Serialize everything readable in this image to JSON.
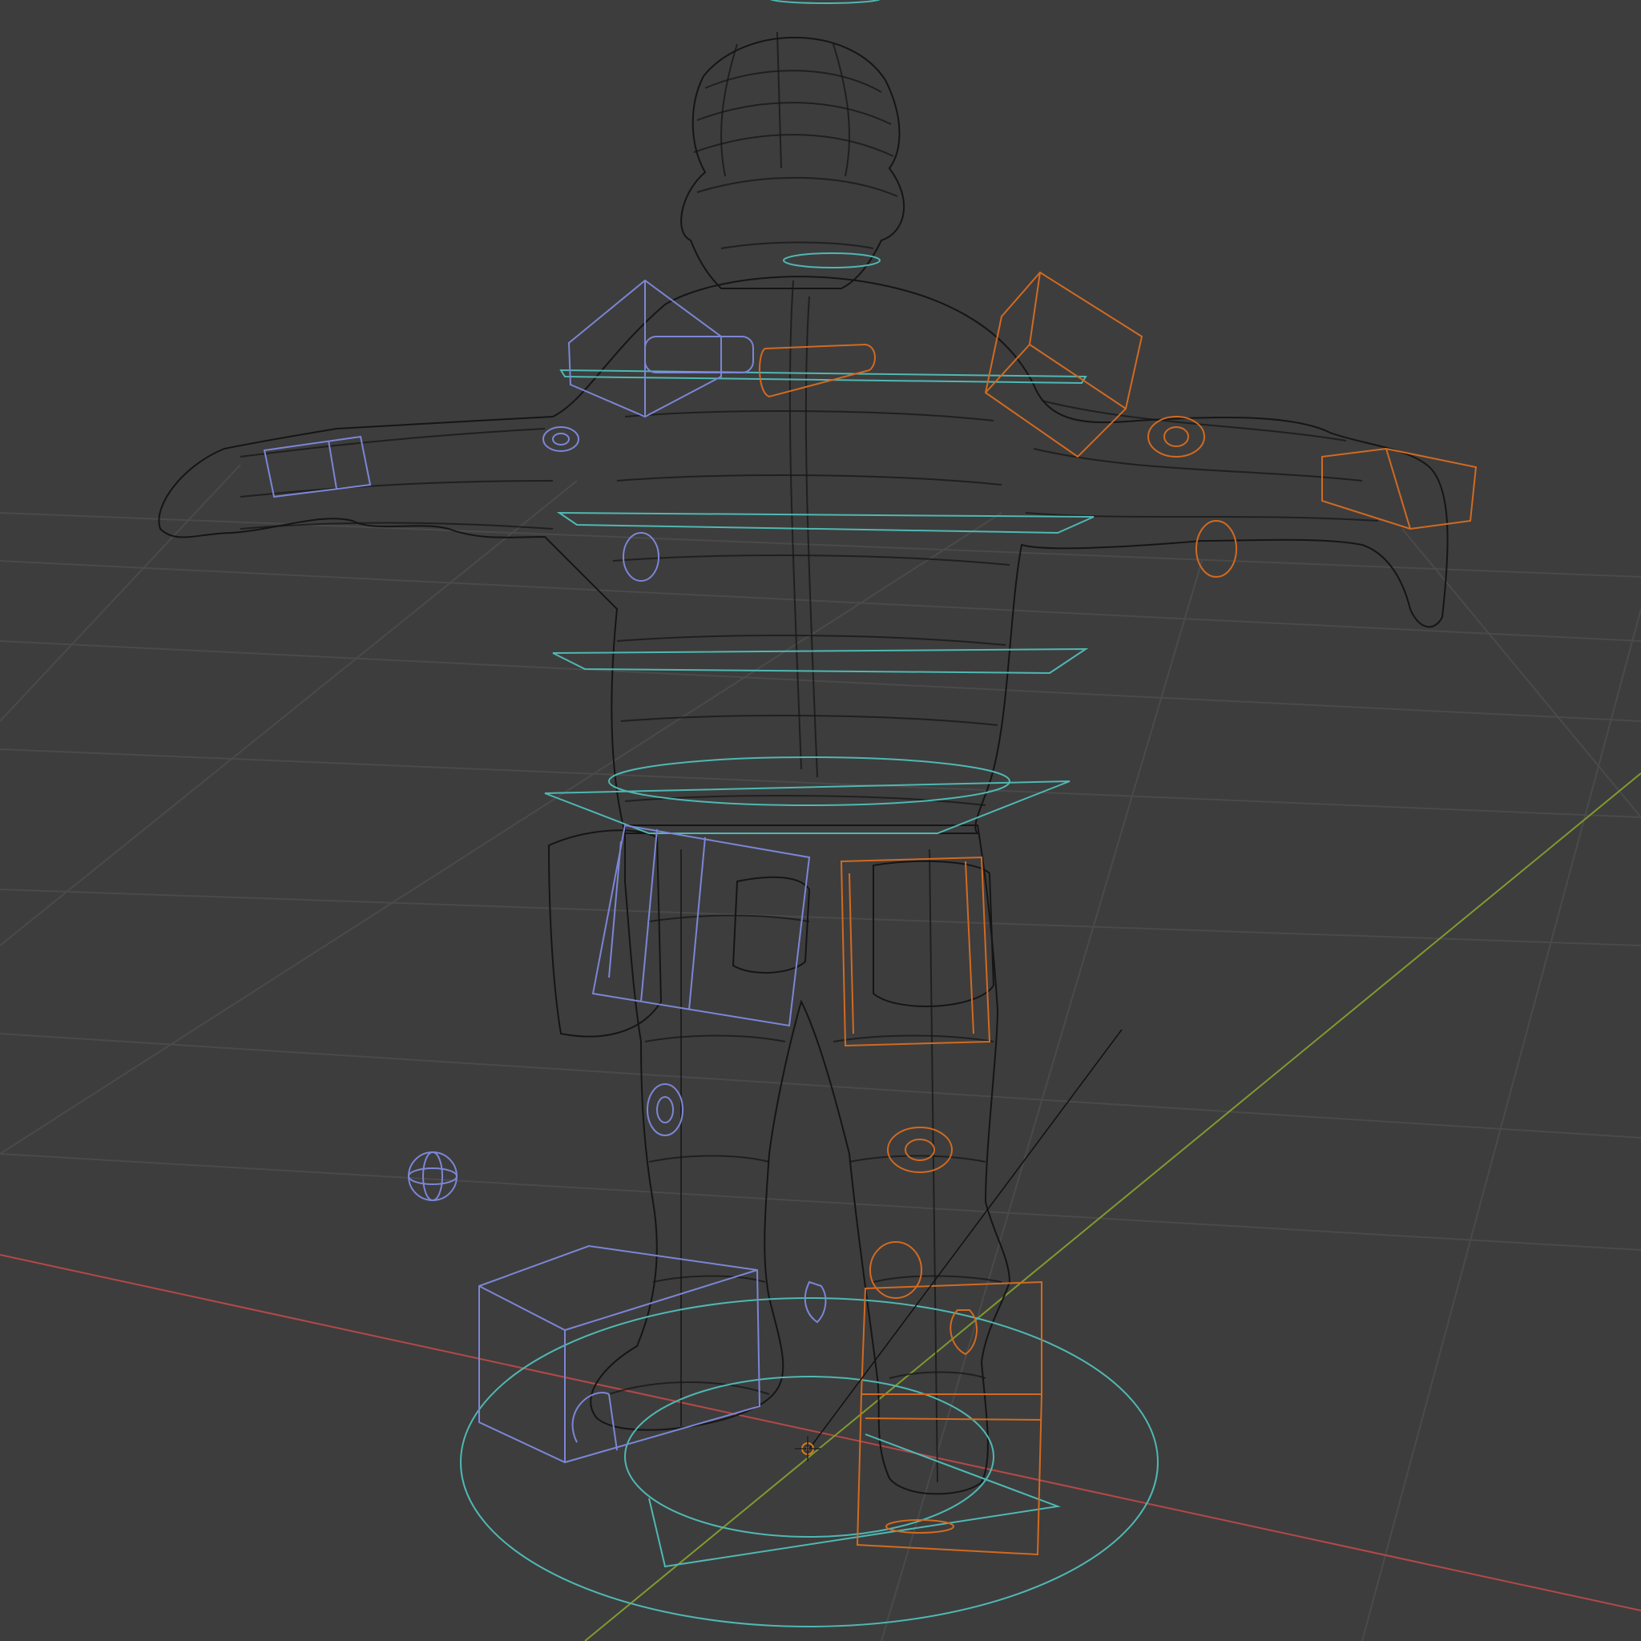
{
  "viewport": {
    "background_color": "#3d3d3d",
    "grid_color": "#4a4a4a",
    "axis_x_color": "#b54848",
    "axis_y_color": "#7f9a30"
  },
  "scene": {
    "view_mode": "wireframe",
    "object": "character-mesh-with-rig",
    "control_colors": {
      "center": "#4fb8b3",
      "right_side": "#7c86d6",
      "left_side": "#d26a21",
      "mesh_wire": "#151515"
    },
    "icons": [
      "3d-cursor-icon",
      "empty-sphere-icon",
      "light-icon"
    ]
  }
}
